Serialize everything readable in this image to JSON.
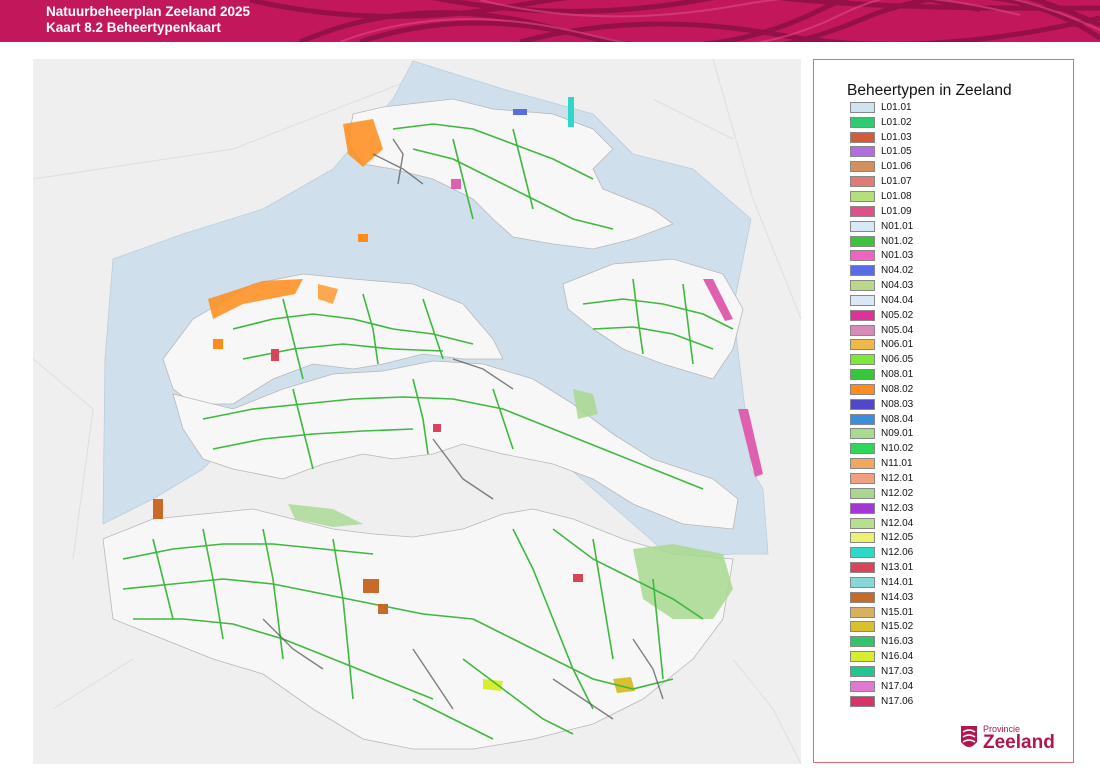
{
  "header": {
    "line1": "Natuurbeheerplan Zeeland 2025",
    "line2": "Kaart 8.2 Beheertypenkaart",
    "color": "#c2185b"
  },
  "legend": {
    "title": "Beheertypen in Zeeland",
    "items": [
      {
        "code": "L01.01",
        "color": "#cfe4ef"
      },
      {
        "code": "L01.02",
        "color": "#2ecc71"
      },
      {
        "code": "L01.03",
        "color": "#d35a3c"
      },
      {
        "code": "L01.05",
        "color": "#b06ee0"
      },
      {
        "code": "L01.06",
        "color": "#d2905e"
      },
      {
        "code": "L01.07",
        "color": "#e07b74"
      },
      {
        "code": "L01.08",
        "color": "#b4e07a"
      },
      {
        "code": "L01.09",
        "color": "#e0508a"
      },
      {
        "code": "N01.01",
        "color": "#d6e9f5"
      },
      {
        "code": "N01.02",
        "color": "#3cc43c"
      },
      {
        "code": "N01.03",
        "color": "#f063c0"
      },
      {
        "code": "N04.02",
        "color": "#5a6be6"
      },
      {
        "code": "N04.03",
        "color": "#b9d88a"
      },
      {
        "code": "N04.04",
        "color": "#d9e8f4"
      },
      {
        "code": "N05.02",
        "color": "#e0309a"
      },
      {
        "code": "N05.04",
        "color": "#d98ab8"
      },
      {
        "code": "N06.01",
        "color": "#f0b84a"
      },
      {
        "code": "N06.05",
        "color": "#7ee83a"
      },
      {
        "code": "N08.01",
        "color": "#36c73a"
      },
      {
        "code": "N08.02",
        "color": "#ff8c1a"
      },
      {
        "code": "N08.03",
        "color": "#5048c8"
      },
      {
        "code": "N08.04",
        "color": "#3a8ee0"
      },
      {
        "code": "N09.01",
        "color": "#a6dc8c"
      },
      {
        "code": "N10.02",
        "color": "#2ed65a"
      },
      {
        "code": "N11.01",
        "color": "#f0a860"
      },
      {
        "code": "N12.01",
        "color": "#f0a080"
      },
      {
        "code": "N12.02",
        "color": "#a8d890"
      },
      {
        "code": "N12.03",
        "color": "#a436d8"
      },
      {
        "code": "N12.04",
        "color": "#b6e08e"
      },
      {
        "code": "N12.05",
        "color": "#eef070"
      },
      {
        "code": "N12.06",
        "color": "#2ed8c8"
      },
      {
        "code": "N13.01",
        "color": "#d84458"
      },
      {
        "code": "N14.01",
        "color": "#86d8d8"
      },
      {
        "code": "N14.03",
        "color": "#c86a28"
      },
      {
        "code": "N15.01",
        "color": "#d8b060"
      },
      {
        "code": "N15.02",
        "color": "#d8c030"
      },
      {
        "code": "N16.03",
        "color": "#34c46a"
      },
      {
        "code": "N16.04",
        "color": "#d8ec30"
      },
      {
        "code": "N17.03",
        "color": "#1ec890"
      },
      {
        "code": "N17.04",
        "color": "#e07ad0"
      },
      {
        "code": "N17.06",
        "color": "#d83468"
      }
    ]
  },
  "logo": {
    "line1": "Provincie",
    "line2": "Zeeland"
  }
}
